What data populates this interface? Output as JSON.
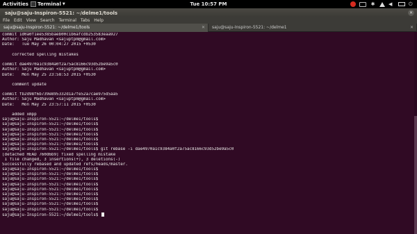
{
  "topbar": {
    "activities": "Activities",
    "app_label": "Terminal",
    "clock": "Tue 10:57 PM"
  },
  "window": {
    "title": "saju@saju-Inspiron-5521: ~/delme1/tools"
  },
  "menu": [
    "File",
    "Edit",
    "View",
    "Search",
    "Terminal",
    "Tabs",
    "Help"
  ],
  "tabs": [
    {
      "label": "saju@saju-Inspiron-5521: ~/delme1/tools",
      "active": true
    },
    {
      "label": "saju@saju-Inspiron-5521: ~/delme1",
      "active": false
    }
  ],
  "terminal": {
    "lines": [
      "commit 1d0a0f1ee5385baeb00c1b6afcdb253583eaa927",
      "Author: Saju Madhavan <sajuptpm@gmail.com>",
      "Date:   Tue May 26 00:04:27 2015 +0530",
      "",
      "    corrected spelling mistakes",
      "",
      "commit dae4970a1c9384a0f2a75ac8166c93d52be9a5c0",
      "Author: Saju Madhavan <sajuptpm@gmail.com>",
      "Date:   Mon May 25 23:58:53 2015 +0530",
      "",
      "    comment update",
      "",
      "commit fb2d98f6b739e895332d1a7fe52a7cae975d5aa5",
      "Author: Saju Madhavan <sajuptpm@gmail.com>",
      "Date:   Mon May 25 23:57:11 2015 +0530",
      "",
      "    added xmpp",
      "saju@saju-Inspiron-5521:~/delme1/tools$",
      "saju@saju-Inspiron-5521:~/delme1/tools$",
      "saju@saju-Inspiron-5521:~/delme1/tools$",
      "saju@saju-Inspiron-5521:~/delme1/tools$",
      "saju@saju-Inspiron-5521:~/delme1/tools$",
      "saju@saju-Inspiron-5521:~/delme1/tools$",
      "saju@saju-Inspiron-5521:~/delme1/tools$ git rebase -i dae4970a1c9384a0f2a75ac8166c93d52be9a5c0",
      "[detached HEAD 760d6b9] fixed spelling mistake",
      " 1 file changed, 3 insertions(+), 3 deletions(-)",
      "Successfully rebased and updated refs/heads/master.",
      "saju@saju-Inspiron-5521:~/delme1/tools$",
      "saju@saju-Inspiron-5521:~/delme1/tools$",
      "saju@saju-Inspiron-5521:~/delme1/tools$",
      "saju@saju-Inspiron-5521:~/delme1/tools$",
      "saju@saju-Inspiron-5521:~/delme1/tools$",
      "saju@saju-Inspiron-5521:~/delme1/tools$",
      "saju@saju-Inspiron-5521:~/delme1/tools$",
      "saju@saju-Inspiron-5521:~/delme1/tools$",
      "saju@saju-Inspiron-5521:~/delme1/tools$",
      "saju@saju-Inspiron-5521:~/delme1/tools$"
    ]
  },
  "colors": {
    "terminal_bg": "#300a24",
    "terminal_fg": "#eeeeec",
    "topbar_bg": "#000000",
    "titlebar_bg": "#3c3b37"
  }
}
